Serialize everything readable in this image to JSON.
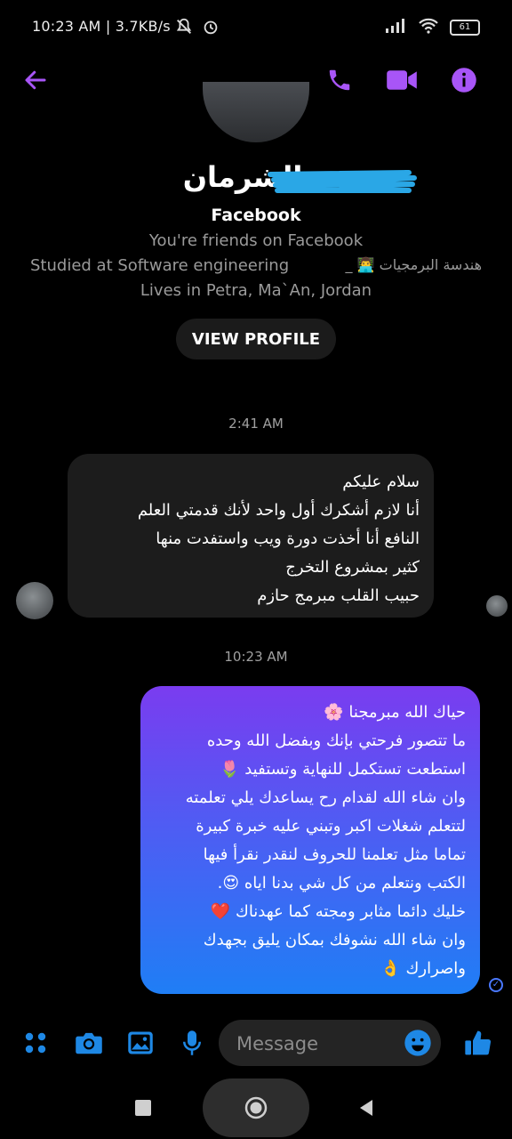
{
  "status_bar": {
    "time_speed": "10:23 AM | 3.7KB/s",
    "battery": "61"
  },
  "header": {
    "back_icon": "arrow-left-icon",
    "call_icon": "phone-icon",
    "video_icon": "video-camera-icon",
    "info_icon": "info-icon",
    "accent_color": "#a855f7"
  },
  "profile": {
    "name": "ة الشرمان",
    "platform": "Facebook",
    "friends": "You're friends on Facebook",
    "studied": "Studied at Software engineering",
    "studied_ar": "هندسة البرمجيات 👨‍💻 _",
    "lives": "Lives in Petra, Ma`An, Jordan",
    "view_profile": "VIEW PROFILE"
  },
  "conversation": {
    "time1": "2:41 AM",
    "incoming_lines": [
      "سلام عليكم",
      "أنا لازم أشكرك أول واحد لأنك قدمتي العلم",
      "النافع أنا أخذت دورة ويب واستفدت منها",
      "كثير بمشروع التخرج",
      "حبيب القلب مبرمج حازم"
    ],
    "time2": "10:23 AM",
    "outgoing_lines": [
      "حياك الله مبرمجنا 🌸",
      "ما تتصور فرحتي بإنك وبفضل الله وحده",
      "استطعت تستكمل للنهاية وتستفيد 🌷",
      "وان شاء الله لقدام رح يساعدك يلي تعلمته",
      "لتتعلم شغلات اكبر وتبني عليه خبرة كبيرة",
      "تماما مثل تعلمنا للحروف لنقدر نقرأ فيها",
      "الكتب ونتعلم من كل شي بدنا اياه 😍.",
      "خليك دائما مثابر ومجته كما عهدناك ❤️",
      "وان شاء الله نشوفك بمكان يليق بجهدك",
      "واصرارك 👌"
    ]
  },
  "composer": {
    "placeholder": "Message",
    "icons": [
      "apps-icon",
      "camera-icon",
      "gallery-icon",
      "microphone-icon",
      "emoji-icon",
      "thumbs-up-icon"
    ],
    "accent_color": "#1e88e5"
  }
}
